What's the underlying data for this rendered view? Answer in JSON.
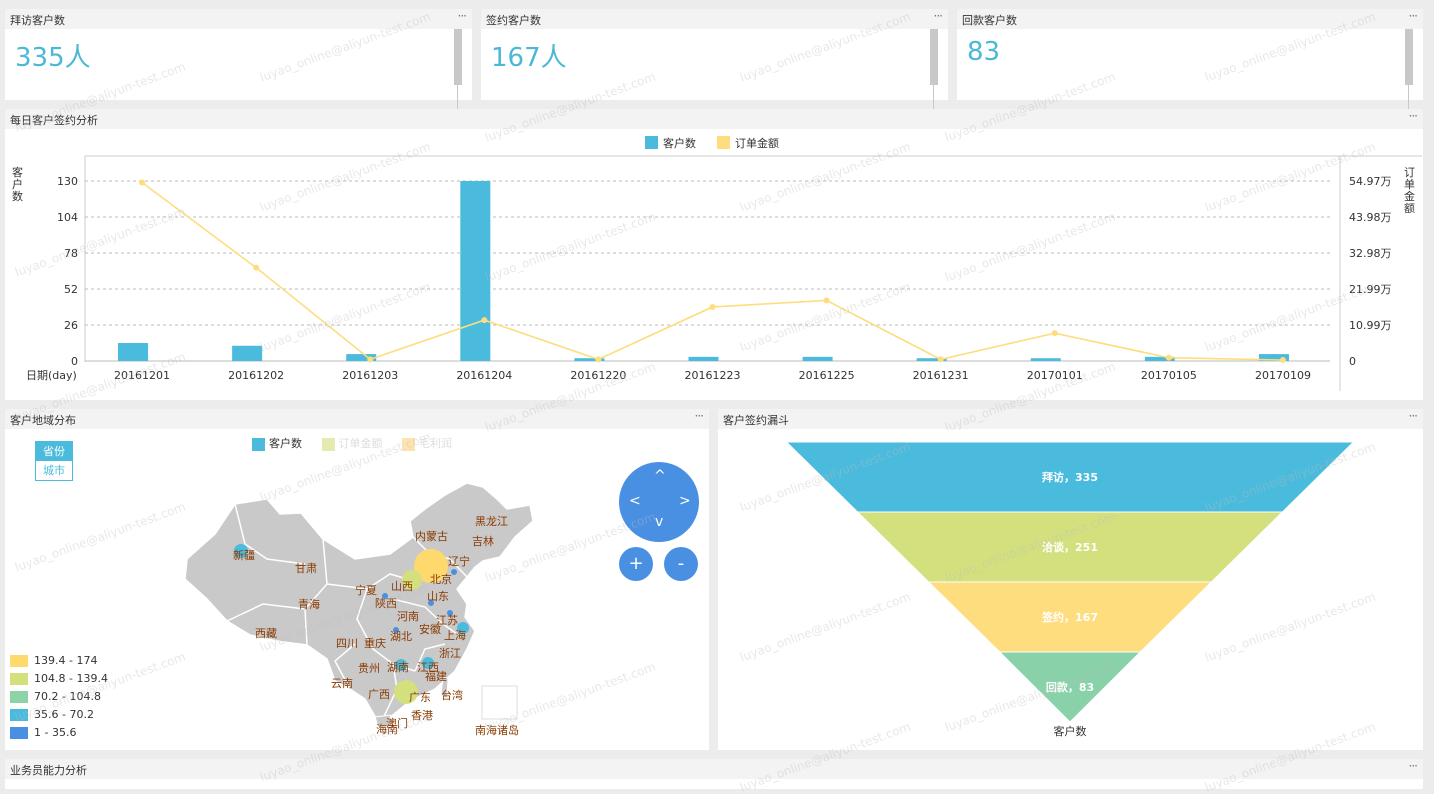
{
  "kpis": [
    {
      "title": "拜访客户数",
      "value": "335人"
    },
    {
      "title": "签约客户数",
      "value": "167人"
    },
    {
      "title": "回款客户数",
      "value": "83"
    }
  ],
  "menu_glyph": "···",
  "watermark": "luyao_online@aliyun-test.com",
  "daily": {
    "title": "每日客户签约分析",
    "legend": [
      {
        "name": "客户数",
        "color": "#4bbbdd"
      },
      {
        "name": "订单金额",
        "color": "#fddd7d"
      }
    ],
    "y_left_label": "客户数",
    "y_right_label": "订单金额",
    "x_label": "日期(day)",
    "left_ticks": [
      "130",
      "104",
      "78",
      "52",
      "26",
      "0"
    ],
    "right_ticks": [
      "54.97万",
      "43.98万",
      "32.98万",
      "21.99万",
      "10.99万",
      "0"
    ]
  },
  "chart_data": {
    "type": "bar",
    "categories": [
      "20161201",
      "20161202",
      "20161203",
      "20161204",
      "20161220",
      "20161223",
      "20161225",
      "20161231",
      "20170101",
      "20170105",
      "20170109"
    ],
    "series": [
      {
        "name": "客户数",
        "type": "bar",
        "axis": "left",
        "values": [
          13,
          11,
          5,
          130,
          2,
          3,
          3,
          2,
          2,
          3,
          5
        ]
      },
      {
        "name": "订单金额",
        "type": "line",
        "axis": "right",
        "unit": "万",
        "values": [
          54.5,
          28.5,
          0.5,
          12.5,
          0.5,
          16.5,
          18.5,
          0.5,
          8.5,
          1.0,
          0.3
        ]
      }
    ],
    "ylim_left": [
      0,
      130
    ],
    "ylim_right": [
      0,
      54.97
    ],
    "xlabel": "日期(day)",
    "ylabel_left": "客户数",
    "ylabel_right": "订单金额",
    "legend_position": "top-center",
    "grid": true
  },
  "region": {
    "title": "客户地域分布",
    "legend": [
      {
        "name": "客户数",
        "color": "#4bbbdd",
        "faded": false
      },
      {
        "name": "订单金额",
        "color": "#e4eab0",
        "faded": true
      },
      {
        "name": "毛利润",
        "color": "#fde3b0",
        "faded": true
      }
    ],
    "toggle": {
      "active": "省份",
      "inactive": "城市"
    },
    "zoom": {
      "in": "+",
      "out": "-"
    },
    "nav": {
      "up": "^",
      "down": "v",
      "left": "<",
      "right": ">"
    },
    "provinces": [
      {
        "name": "黑龙江"
      },
      {
        "name": "吉林"
      },
      {
        "name": "内蒙古"
      },
      {
        "name": "辽宁"
      },
      {
        "name": "新疆"
      },
      {
        "name": "甘肃"
      },
      {
        "name": "北京"
      },
      {
        "name": "宁夏"
      },
      {
        "name": "山西"
      },
      {
        "name": "山东"
      },
      {
        "name": "陕西"
      },
      {
        "name": "青海"
      },
      {
        "name": "河南"
      },
      {
        "name": "江苏"
      },
      {
        "name": "西藏"
      },
      {
        "name": "湖北"
      },
      {
        "name": "安徽"
      },
      {
        "name": "四川"
      },
      {
        "name": "重庆"
      },
      {
        "name": "上海"
      },
      {
        "name": "浙江"
      },
      {
        "name": "贵州"
      },
      {
        "name": "湖南"
      },
      {
        "name": "江西"
      },
      {
        "name": "福建"
      },
      {
        "name": "云南"
      },
      {
        "name": "广西"
      },
      {
        "name": "广东"
      },
      {
        "name": "台湾"
      },
      {
        "name": "香港"
      },
      {
        "name": "澳门"
      },
      {
        "name": "海南"
      },
      {
        "name": "南海诸岛"
      }
    ],
    "range_legend": [
      {
        "label": "139.4 - 174",
        "color": "#fdd96e"
      },
      {
        "label": "104.8 - 139.4",
        "color": "#d3e07d"
      },
      {
        "label": "70.2 - 104.8",
        "color": "#8ed3a8"
      },
      {
        "label": "35.6 - 70.2",
        "color": "#4bbbdd"
      },
      {
        "label": "1 - 35.6",
        "color": "#4a90e2"
      }
    ]
  },
  "funnel": {
    "title": "客户签约漏斗",
    "stages": [
      {
        "label": "拜访，335",
        "value": 335,
        "color": "#4bbbdd"
      },
      {
        "label": "洽谈，251",
        "value": 251,
        "color": "#d3e07d"
      },
      {
        "label": "签约，167",
        "value": 167,
        "color": "#fddd7d"
      },
      {
        "label": "回款，83",
        "value": 83,
        "color": "#88d1a9"
      }
    ],
    "axis_label": "客户数"
  },
  "bottom_panel": {
    "title": "业务员能力分析"
  }
}
